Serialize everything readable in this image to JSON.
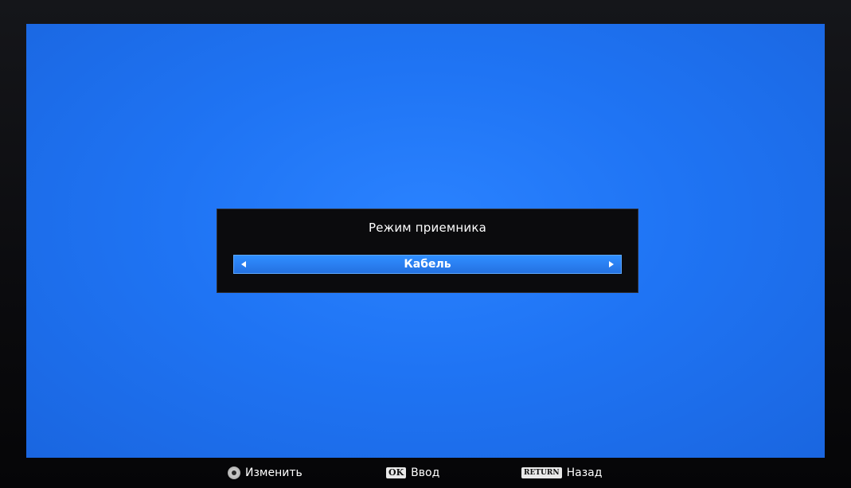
{
  "dialog": {
    "title": "Режим приемника",
    "selected_value": "Кабель"
  },
  "footer": {
    "change": {
      "icon": "dpad-icon",
      "label": "Изменить"
    },
    "enter": {
      "key": "OK",
      "label": "Ввод"
    },
    "back": {
      "key": "RETURN",
      "label": "Назад"
    }
  },
  "colors": {
    "screen_blue": "#1f74f4",
    "dialog_bg": "#0b0b0d",
    "selector_blue": "#2a7ef0",
    "text": "#ffffff"
  }
}
